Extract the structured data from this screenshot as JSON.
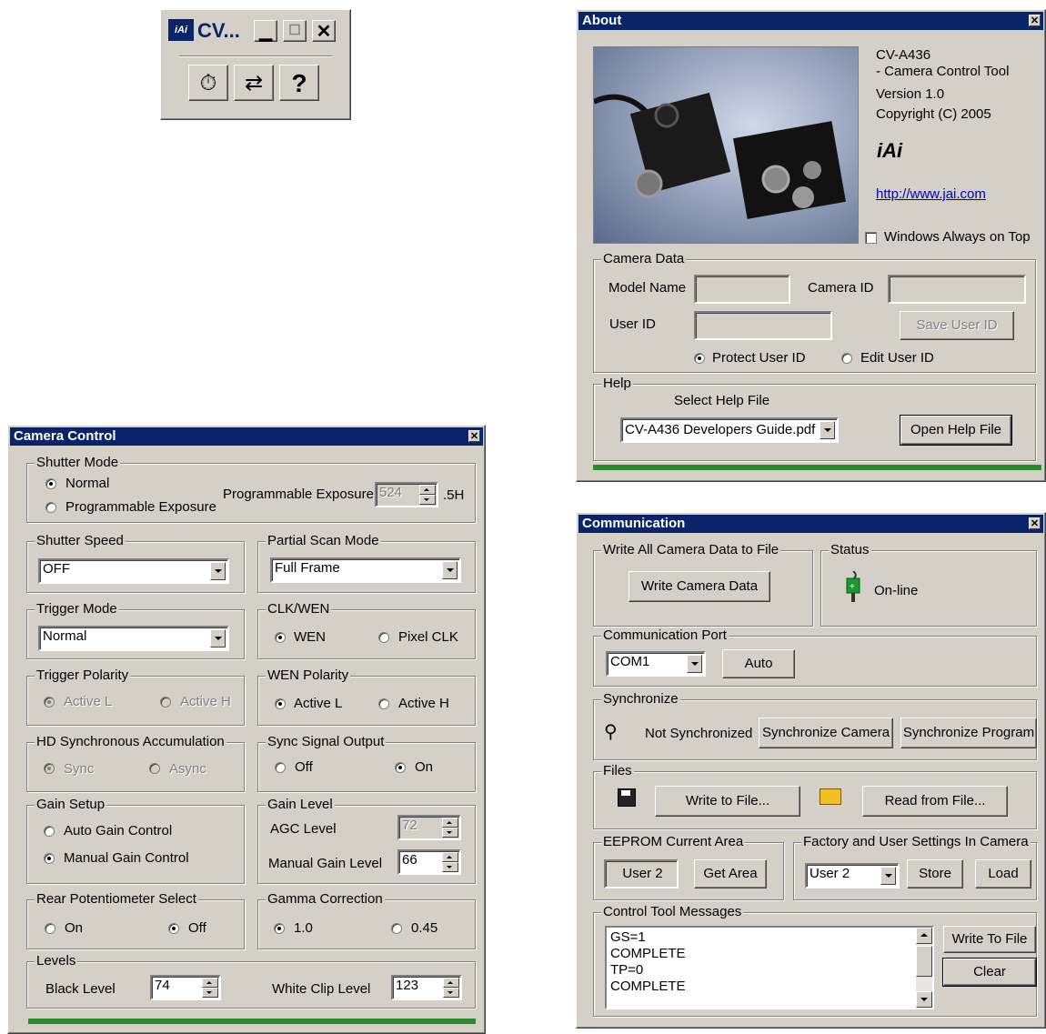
{
  "mini_toolbar": {
    "title": "CV...",
    "icons": [
      "stopwatch-icon",
      "transfer-icon",
      "help-icon"
    ]
  },
  "about": {
    "title": "About",
    "product": "CV-A436",
    "subtitle": "- Camera Control Tool",
    "version": "Version 1.0",
    "copyright": "Copyright (C) 2005",
    "link": "http://www.jai.com",
    "always_on_top": "Windows Always on Top",
    "camera_data": {
      "legend": "Camera Data",
      "model_name_label": "Model Name",
      "model_name_value": "",
      "camera_id_label": "Camera ID",
      "camera_id_value": "",
      "user_id_label": "User ID",
      "user_id_value": "",
      "save_user_id": "Save User ID",
      "protect_user_id": "Protect User ID",
      "edit_user_id": "Edit User ID"
    },
    "help": {
      "legend": "Help",
      "select_label": "Select Help File",
      "selected_file": "CV-A436 Developers Guide.pdf",
      "open_button": "Open Help File"
    }
  },
  "camera_control": {
    "title": "Camera Control",
    "shutter_mode": {
      "legend": "Shutter Mode",
      "normal": "Normal",
      "programmable": "Programmable Exposure",
      "exposure_label": "Programmable Exposure",
      "exposure_value": "524",
      "exposure_unit": ".5H"
    },
    "shutter_speed": {
      "legend": "Shutter Speed",
      "value": "OFF"
    },
    "partial_scan": {
      "legend": "Partial Scan Mode",
      "value": "Full Frame"
    },
    "trigger_mode": {
      "legend": "Trigger Mode",
      "value": "Normal"
    },
    "clk_wen": {
      "legend": "CLK/WEN",
      "opt1": "WEN",
      "opt2": "Pixel CLK"
    },
    "trigger_polarity": {
      "legend": "Trigger Polarity",
      "opt1": "Active L",
      "opt2": "Active H"
    },
    "wen_polarity": {
      "legend": "WEN Polarity",
      "opt1": "Active L",
      "opt2": "Active H"
    },
    "hd_sync": {
      "legend": "HD Synchronous Accumulation",
      "opt1": "Sync",
      "opt2": "Async"
    },
    "sync_output": {
      "legend": "Sync Signal Output",
      "opt1": "Off",
      "opt2": "On"
    },
    "gain_setup": {
      "legend": "Gain Setup",
      "opt1": "Auto Gain Control",
      "opt2": "Manual Gain Control"
    },
    "gain_level": {
      "legend": "Gain Level",
      "agc_label": "AGC Level",
      "agc_value": "72",
      "manual_label": "Manual Gain Level",
      "manual_value": "66"
    },
    "rear_pot": {
      "legend": "Rear Potentiometer Select",
      "opt1": "On",
      "opt2": "Off"
    },
    "gamma": {
      "legend": "Gamma Correction",
      "opt1": "1.0",
      "opt2": "0.45"
    },
    "levels": {
      "legend": "Levels",
      "black_label": "Black Level",
      "black_value": "74",
      "white_label": "White Clip Level",
      "white_value": "123"
    }
  },
  "communication": {
    "title": "Communication",
    "write_all": {
      "legend": "Write All Camera Data to File",
      "button": "Write Camera Data"
    },
    "status": {
      "legend": "Status",
      "value": "On-line"
    },
    "port": {
      "legend": "Communication Port",
      "value": "COM1",
      "auto": "Auto"
    },
    "sync": {
      "legend": "Synchronize",
      "state": "Not Synchronized",
      "btn_camera": "Synchronize Camera",
      "btn_program": "Synchronize Program"
    },
    "files": {
      "legend": "Files",
      "write": "Write to File...",
      "read": "Read from File..."
    },
    "eeprom": {
      "legend": "EEPROM Current Area",
      "value": "User 2",
      "get_area": "Get Area"
    },
    "factory": {
      "legend": "Factory and User Settings In Camera",
      "value": "User 2",
      "store": "Store",
      "load": "Load"
    },
    "messages": {
      "legend": "Control Tool Messages",
      "lines": [
        "GS=1",
        "COMPLETE",
        "TP=0",
        "COMPLETE"
      ],
      "write_to_file": "Write To File",
      "clear": "Clear"
    }
  }
}
